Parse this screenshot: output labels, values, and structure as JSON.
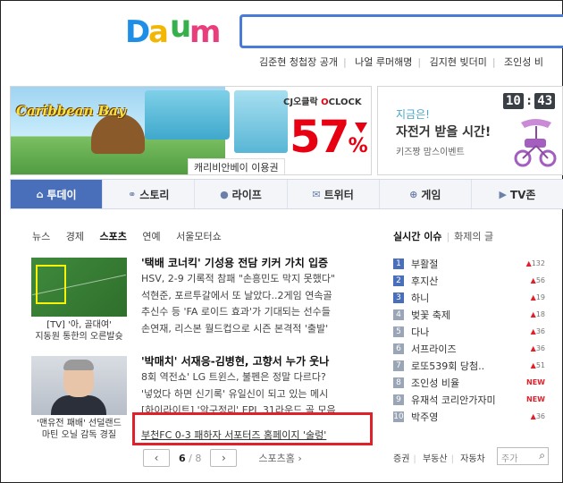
{
  "header": {
    "logo": "Daum",
    "search_placeholder": "",
    "keywords": [
      "김준현 청첩장 공개",
      "나얼 루머해명",
      "김지현 빚더미",
      "조인성 비"
    ]
  },
  "banners": {
    "left": {
      "title": "Caribbean Bay",
      "caption": "캐리비안베이 이용권",
      "badge_brand": "CJ오클락",
      "badge_clock": "CLOCK",
      "percent": "57",
      "percent_sign": "%"
    },
    "right": {
      "line1": "지금은!",
      "line2": "자전거 받을 시간!",
      "line3": "키즈짱 맘스이벤트",
      "clock_hh": "10",
      "clock_mm": "43"
    }
  },
  "nav": {
    "tabs": [
      {
        "label": "투데이",
        "icon": "home-icon",
        "glyph": "⌂"
      },
      {
        "label": "스토리",
        "icon": "link-icon",
        "glyph": "⚭"
      },
      {
        "label": "라이프",
        "icon": "life-icon",
        "glyph": "●"
      },
      {
        "label": "트위터",
        "icon": "twitter-icon",
        "glyph": "✉"
      },
      {
        "label": "게임",
        "icon": "game-icon",
        "glyph": "⊕"
      },
      {
        "label": "TV존",
        "icon": "tv-icon",
        "glyph": "▶"
      }
    ],
    "active_index": 0
  },
  "subtabs": [
    "뉴스",
    "경제",
    "스포츠",
    "연예",
    "서울모터쇼"
  ],
  "subtabs_active": 2,
  "news": {
    "thumb1_caption_1": "[TV] '아, 골대여'",
    "thumb1_caption_2": "지동원 통한의 오른발슛",
    "thumb2_caption_1": "'맨유전 패배' 선덜랜드",
    "thumb2_caption_2": "마틴 오닐 감독 경질",
    "block1": {
      "headline": "'택배 코너킥' 기성용 전담 키커 가치 입증",
      "lines": [
        "HSV, 2-9 기록적 참패 \"손흥민도 막지 못했다\"",
        "석현준, 포르투갈에서 또 날았다..2게임 연속골",
        "추신수 등 'FA 로이드 효과'가 기대되는 선수들",
        "손연재, 리스본 월드컵으로 시즌 본격적 '출발'"
      ]
    },
    "block2": {
      "headline": "'박매치' 서재응-김병현, 고향서 누가 웃나",
      "lines": [
        "8회 역전쇼' LG 트윈스, 불펜은 정말 다르다?",
        "'넣었다 하면 신기록' 유일신이 되고 있는 메시",
        "[하이라이트] '악구정리' EPL 31라운드 골 모음"
      ],
      "highlighted": "부천FC 0-3 패하자 서포터즈 홈페이지 '술렁'"
    },
    "pager": {
      "prev": "‹",
      "current": "6",
      "total": "/ 8",
      "next": "›",
      "more": "스포츠홈 ›"
    }
  },
  "realtime": {
    "tab_active": "실시간 이슈",
    "tab_other": "화제의 글",
    "items": [
      {
        "rank": "1",
        "term": "부활절",
        "delta": "132",
        "new": false
      },
      {
        "rank": "2",
        "term": "후지산",
        "delta": "56",
        "new": false
      },
      {
        "rank": "3",
        "term": "하니",
        "delta": "19",
        "new": false
      },
      {
        "rank": "4",
        "term": "벚꽃 축제",
        "delta": "18",
        "new": false
      },
      {
        "rank": "5",
        "term": "다나",
        "delta": "36",
        "new": false
      },
      {
        "rank": "6",
        "term": "서프라이즈",
        "delta": "36",
        "new": false
      },
      {
        "rank": "7",
        "term": "로또539회 당첨..",
        "delta": "51",
        "new": false
      },
      {
        "rank": "8",
        "term": "조인성 비율",
        "delta": "NEW",
        "new": true
      },
      {
        "rank": "9",
        "term": "유재석 코리안가자미",
        "delta": "NEW",
        "new": true
      },
      {
        "rank": "10",
        "term": "박주영",
        "delta": "36",
        "new": false
      }
    ],
    "up_arrow": "▲",
    "bottom_links": [
      "증권",
      "부동산",
      "자동차"
    ],
    "search_placeholder": "주가"
  },
  "colors": {
    "brand_blue": "#4a6fba",
    "accent_red": "#e0202a",
    "logo_d": "#1f8ee6",
    "logo_a": "#f2b705",
    "logo_u": "#36b04a",
    "logo_m": "#e93d7c"
  }
}
